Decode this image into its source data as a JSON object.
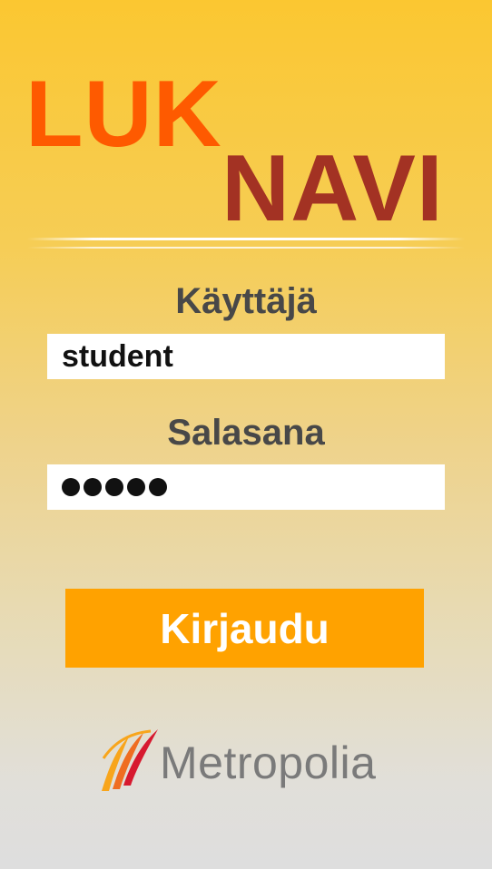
{
  "app": {
    "logo_line1": "LUK",
    "logo_line2": "NAVI"
  },
  "login_form": {
    "username_label": "Käyttäjä",
    "username_value": "student",
    "password_label": "Salasana",
    "password_masked_length": 5,
    "submit_label": "Kirjaudu"
  },
  "footer": {
    "brand_name": "Metropolia",
    "brand_icon": "metropolia-flame-logo"
  },
  "colors": {
    "luk": "#fe5a00",
    "navi": "#a33223",
    "button": "#ffa200",
    "label": "#484848",
    "brand_text": "#7a7a7a"
  }
}
